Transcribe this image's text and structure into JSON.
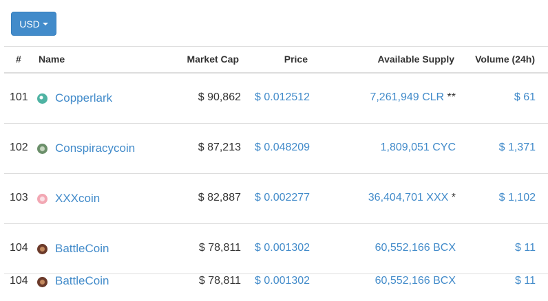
{
  "toolbar": {
    "currency_label": "USD"
  },
  "table": {
    "headers": {
      "rank": "#",
      "name": "Name",
      "market_cap": "Market Cap",
      "price": "Price",
      "supply": "Available Supply",
      "volume": "Volume (24h)"
    },
    "rows": [
      {
        "rank": "101",
        "name": "Copperlark",
        "icon": "copperlark-coin-icon",
        "market_cap": "$ 90,862",
        "price": "$ 0.012512",
        "supply": "7,261,949 CLR",
        "supply_note": " **",
        "volume": "$ 61"
      },
      {
        "rank": "102",
        "name": "Conspiracycoin",
        "icon": "conspiracycoin-coin-icon",
        "market_cap": "$ 87,213",
        "price": "$ 0.048209",
        "supply": "1,809,051 CYC",
        "supply_note": "",
        "volume": "$ 1,371"
      },
      {
        "rank": "103",
        "name": "XXXcoin",
        "icon": "xxxcoin-coin-icon",
        "market_cap": "$ 82,887",
        "price": "$ 0.002277",
        "supply": "36,404,701 XXX",
        "supply_note": " *",
        "volume": "$ 1,102"
      },
      {
        "rank": "104",
        "name": "BattleCoin",
        "icon": "battlecoin-coin-icon",
        "market_cap": "$ 78,811",
        "price": "$ 0.001302",
        "supply": "60,552,166 BCX",
        "supply_note": "",
        "volume": "$ 11"
      },
      {
        "rank": "104",
        "name": "BattleCoin",
        "icon": "battlecoin-coin-icon",
        "market_cap": "$ 78,811",
        "price": "$ 0.001302",
        "supply": "60,552,166 BCX",
        "supply_note": "",
        "volume": "$ 11"
      }
    ]
  },
  "colors": {
    "accent": "#428bca",
    "copperlark": "#4fb3a3",
    "conspiracycoin": "#6b8f6a",
    "xxxcoin": "#f2a7b3",
    "battlecoin": "#6b3a2a"
  }
}
